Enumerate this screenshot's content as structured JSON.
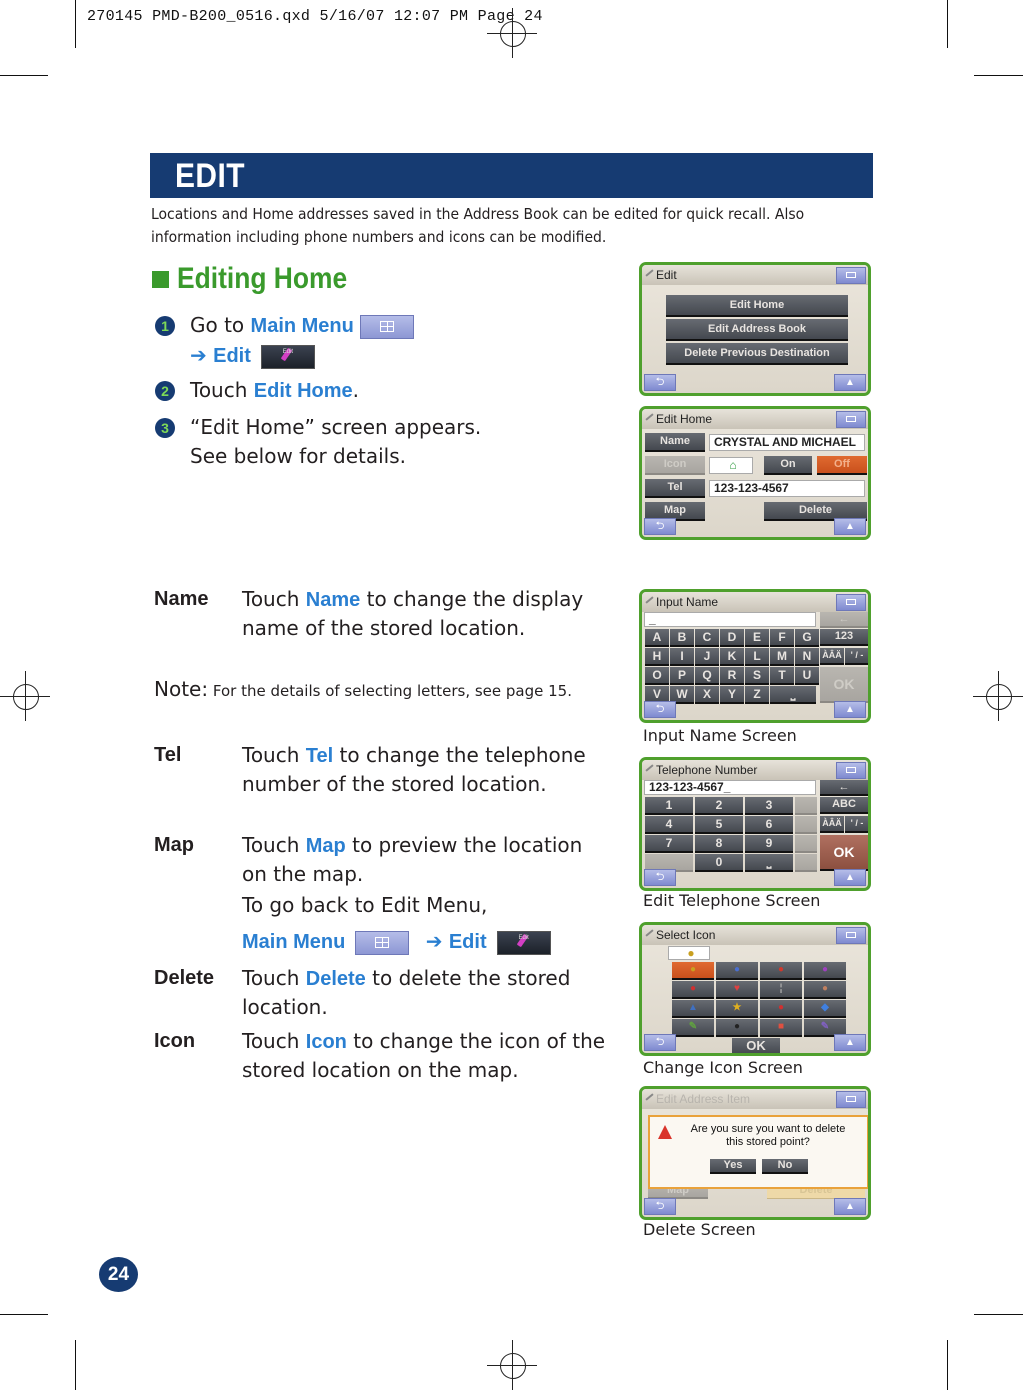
{
  "slug": "270145 PMD-B200_0516.qxd  5/16/07  12:07 PM  Page 24",
  "header": {
    "title": "EDIT",
    "band_color": "#163b72"
  },
  "intro": "Locations and Home addresses saved in the Address Book can be edited for quick recall. Also information including phone numbers and icons can be modified.",
  "section": {
    "title": "Editing Home",
    "accent": "#3a9a2c"
  },
  "steps": [
    {
      "num": "1",
      "pre": "Go to ",
      "link": "Main Menu",
      "arrow": "➔",
      "link2": "Edit",
      "icon_label": "Edit"
    },
    {
      "num": "2",
      "pre": "Touch ",
      "link": "Edit Home",
      "post": "."
    },
    {
      "num": "3",
      "line1": "“Edit Home” screen appears.",
      "line2": "See below for details."
    }
  ],
  "defs": {
    "name": {
      "term": "Name",
      "pre": "Touch ",
      "link": "Name",
      "post": " to change the display name of the stored location."
    },
    "note": {
      "label": "Note:",
      "text": " For the details of selecting letters, see page 15."
    },
    "tel": {
      "term": "Tel",
      "pre": "Touch ",
      "link": "Tel",
      "post": " to change the telephone number of the stored location."
    },
    "map": {
      "term": "Map",
      "pre": "Touch ",
      "link": "Map",
      "post": " to preview the location on the map.",
      "back": "To go back to Edit Menu,",
      "menu_link": "Main Menu",
      "arrow": "➔",
      "edit_link": "Edit",
      "icon_label": "Edit"
    },
    "delete": {
      "term": "Delete",
      "pre": "Touch ",
      "link": "Delete",
      "post": " to delete the stored location."
    },
    "icon": {
      "term": "Icon",
      "pre": "Touch ",
      "link": "Icon",
      "post": " to change the icon of the stored location on the map."
    }
  },
  "screens": {
    "edit": {
      "title": "Edit",
      "buttons": [
        "Edit Home",
        "Edit Address Book",
        "Delete Previous Destination"
      ]
    },
    "edit_home": {
      "title": "Edit Home",
      "name_label": "Name",
      "name_value": "CRYSTAL AND MICHAEL",
      "icon_label": "Icon",
      "on": "On",
      "off": "Off",
      "tel_label": "Tel",
      "tel_value": "123-123-4567",
      "map": "Map",
      "delete": "Delete"
    },
    "input_name": {
      "title": "Input Name",
      "value": "_",
      "backspace": "←",
      "rows": [
        [
          "A",
          "B",
          "C",
          "D",
          "E",
          "F",
          "G"
        ],
        [
          "H",
          "I",
          "J",
          "K",
          "L",
          "M",
          "N"
        ],
        [
          "O",
          "P",
          "Q",
          "R",
          "S",
          "T",
          "U"
        ],
        [
          "V",
          "W",
          "X",
          "Y",
          "Z"
        ]
      ],
      "num_key": "123",
      "accent_key": "ÀÂÄ",
      "punct_key": "' / -",
      "space_key": "⎵",
      "ok": "OK",
      "caption": "Input Name Screen"
    },
    "telephone": {
      "title": "Telephone Number",
      "value": "123-123-4567_",
      "backspace": "←",
      "keys": [
        "1",
        "2",
        "3",
        "4",
        "5",
        "6",
        "7",
        "8",
        "9",
        "0"
      ],
      "space_key": "⎵",
      "abc_key": "ABC",
      "accent_key": "ÀÂÄ",
      "punct_key": "' / -",
      "ok": "OK",
      "caption": "Edit Telephone Screen"
    },
    "select_icon": {
      "title": "Select Icon",
      "ok": "OK",
      "caption": "Change Icon Screen"
    },
    "delete": {
      "title": "Edit Address Item",
      "message_line1": "Are you sure you want to delete",
      "message_line2": "this stored point?",
      "yes": "Yes",
      "no": "No",
      "bg_map": "Map",
      "bg_delete": "Delete",
      "caption": "Delete Screen"
    }
  },
  "page_number": "24"
}
